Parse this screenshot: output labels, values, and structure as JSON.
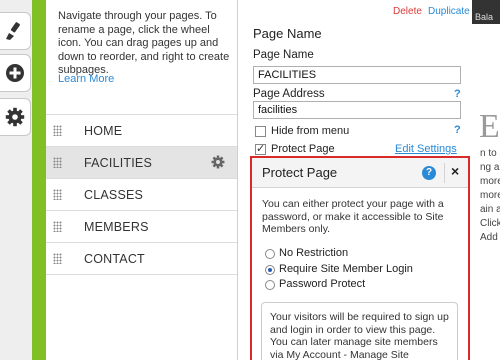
{
  "toolbar": {
    "buttons": [
      {
        "icon": "brush-icon"
      },
      {
        "icon": "plus-circle-icon"
      },
      {
        "icon": "gear-icon"
      }
    ],
    "accent_color": "#80c024"
  },
  "pages_panel": {
    "intro": "Navigate through your pages. To rename a page, click the wheel icon. You can drag pages up and down to reorder, and right to create subpages.",
    "learn_more": "Learn More",
    "pages": [
      {
        "label": "HOME",
        "selected": false
      },
      {
        "label": "FACILITIES",
        "selected": true
      },
      {
        "label": "CLASSES",
        "selected": false
      },
      {
        "label": "MEMBERS",
        "selected": false
      },
      {
        "label": "CONTACT",
        "selected": false
      }
    ]
  },
  "settings": {
    "delete": "Delete",
    "duplicate": "Duplicate",
    "title": "Page Name",
    "page_name_label": "Page Name",
    "page_name_value": "FACILITIES",
    "page_address_label": "Page Address",
    "page_address_value": "facilities",
    "help": "?",
    "hide_from_menu": "Hide from menu",
    "hide_from_menu_checked": false,
    "protect_page": "Protect Page",
    "protect_page_checked": true,
    "edit_settings": "Edit Settings"
  },
  "protect_dialog": {
    "title": "Protect Page",
    "help": "?",
    "close": "×",
    "description": "You can either protect your page with a password, or make it accessible to Site Members only.",
    "options": [
      {
        "label": "No Restriction",
        "checked": false
      },
      {
        "label": "Require Site Member Login",
        "checked": true
      },
      {
        "label": "Password Protect",
        "checked": false
      }
    ],
    "info": "Your visitors will be required to sign up and login in order to view this page. You can later manage site members via My Account - Manage Site Members",
    "border_color": "#d92a2a"
  },
  "preview": {
    "top_text": "Bala",
    "heading": "ES",
    "lines": [
      "n to ac",
      "ng a fr",
      "more f",
      "more d",
      "ain abl",
      "Click \"",
      "Add yo"
    ]
  }
}
